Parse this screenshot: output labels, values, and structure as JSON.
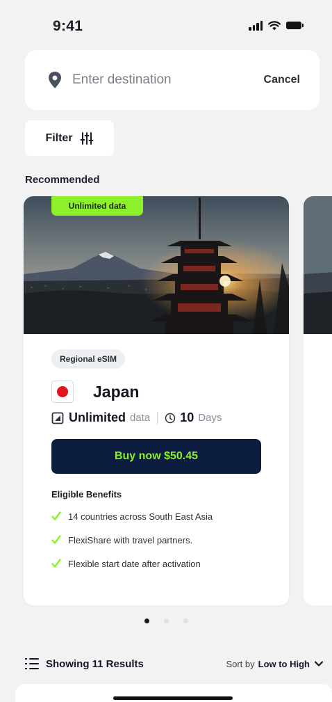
{
  "status_bar": {
    "time": "9:41"
  },
  "search": {
    "placeholder": "Enter destination",
    "cancel_label": "Cancel"
  },
  "filter": {
    "label": "Filter"
  },
  "section": {
    "title": "Recommended"
  },
  "card": {
    "badge": "Unlimited data",
    "type_chip": "Regional eSIM",
    "country": "Japan",
    "data_amount": "Unlimited",
    "data_unit": "data",
    "duration_value": "10",
    "duration_unit": "Days",
    "buy_label": "Buy now $50.45",
    "benefits_title": "Eligible Benefits",
    "benefits": [
      "14 countries across South East Asia",
      "FlexiShare with travel partners.",
      "Flexible start date after activation"
    ]
  },
  "pagination": {
    "total": 3,
    "active": 0
  },
  "results": {
    "label": "Showing 11 Results",
    "sort_prefix": "Sort by",
    "sort_value": "Low to High"
  },
  "colors": {
    "accent": "#8cf12b",
    "primary": "#0c1d3f",
    "flag_red": "#e3141d"
  },
  "icons": [
    "location-pin-icon",
    "sliders-icon",
    "data-icon",
    "clock-icon",
    "check-icon",
    "list-icon",
    "chevron-down-icon"
  ]
}
